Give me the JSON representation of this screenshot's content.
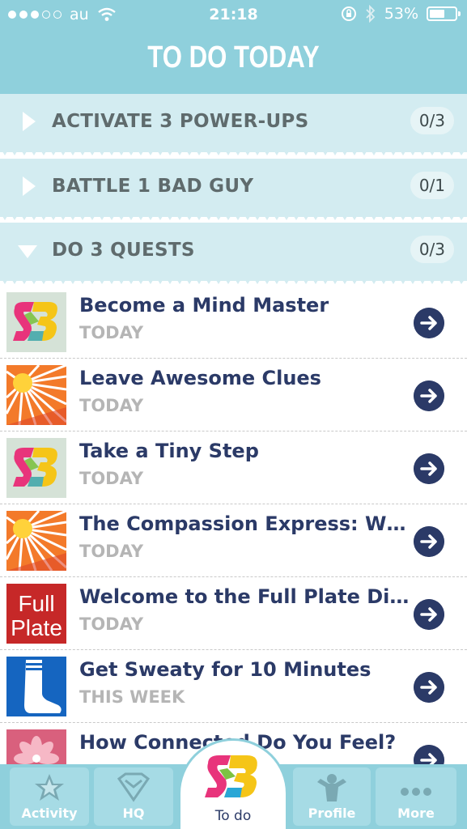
{
  "status": {
    "carrier": "au",
    "time": "21:18",
    "battery": "53%"
  },
  "header": {
    "title": "TO DO TODAY"
  },
  "groups": [
    {
      "label": "ACTIVATE 3 POWER-UPS",
      "count": "0/3",
      "expanded": false
    },
    {
      "label": "BATTLE 1 BAD GUY",
      "count": "0/1",
      "expanded": false
    },
    {
      "label": "DO 3 QUESTS",
      "count": "0/3",
      "expanded": true
    }
  ],
  "quests": [
    {
      "title": "Become a Mind Master",
      "when": "TODAY",
      "thumb": "sb-logo"
    },
    {
      "title": "Leave Awesome Clues",
      "when": "TODAY",
      "thumb": "sunburst"
    },
    {
      "title": "Take a Tiny Step",
      "when": "TODAY",
      "thumb": "sb-logo"
    },
    {
      "title": "The Compassion Express: Wh...",
      "when": "TODAY",
      "thumb": "sunburst"
    },
    {
      "title": "Welcome to the Full Plate Diet!",
      "when": "TODAY",
      "thumb": "full-plate",
      "thumb_text": [
        "Full",
        "Plate"
      ]
    },
    {
      "title": "Get Sweaty for 10 Minutes",
      "when": "THIS WEEK",
      "thumb": "sock"
    },
    {
      "title": "How Connected Do You Feel?",
      "when": "",
      "thumb": "flower"
    }
  ],
  "tabs": {
    "activity": "Activity",
    "hq": "HQ",
    "todo": "To do",
    "profile": "Profile",
    "more": "More"
  },
  "colors": {
    "header": "#8fd0dc",
    "group_bg": "#d3ecf1",
    "title_text": "#2b3a67",
    "when_text": "#b5b5b5"
  }
}
